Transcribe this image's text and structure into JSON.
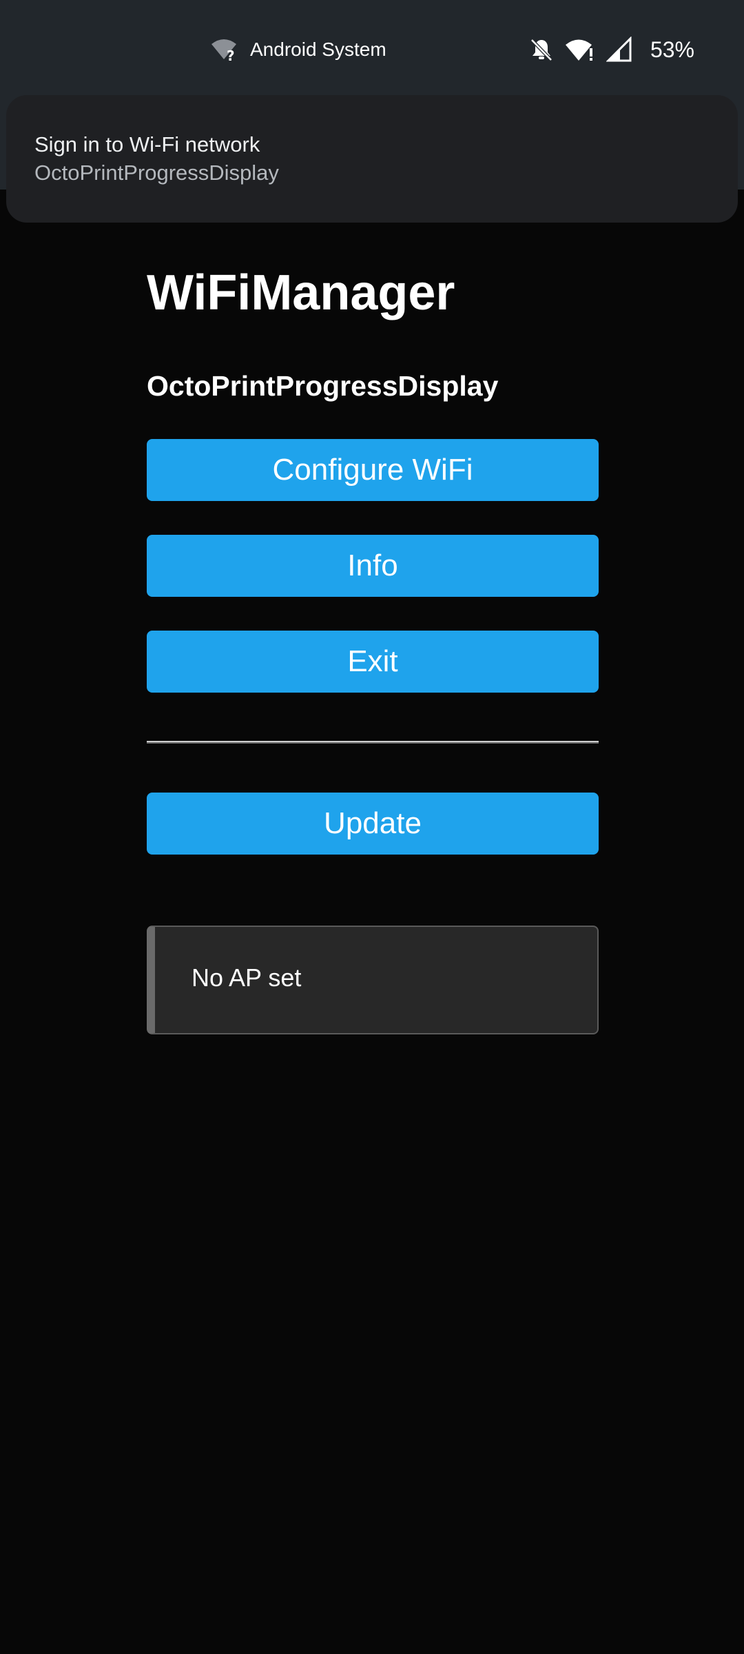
{
  "status_bar": {
    "center_icon": "wifi-question-icon",
    "center_label": "Android System",
    "icons": [
      "bell-off-icon",
      "wifi-alert-icon",
      "cell-signal-icon"
    ],
    "battery": "53%"
  },
  "notification": {
    "title": "Sign in to Wi-Fi network",
    "text": "OctoPrintProgressDisplay"
  },
  "page": {
    "title": "WiFiManager",
    "device_name": "OctoPrintProgressDisplay",
    "buttons": {
      "configure": "Configure WiFi",
      "info": "Info",
      "exit": "Exit",
      "update": "Update"
    },
    "message": "No AP set"
  },
  "colors": {
    "button": "#1fa3ec",
    "background": "#070707",
    "status_bar": "#22272c",
    "message_box": "#282828"
  }
}
